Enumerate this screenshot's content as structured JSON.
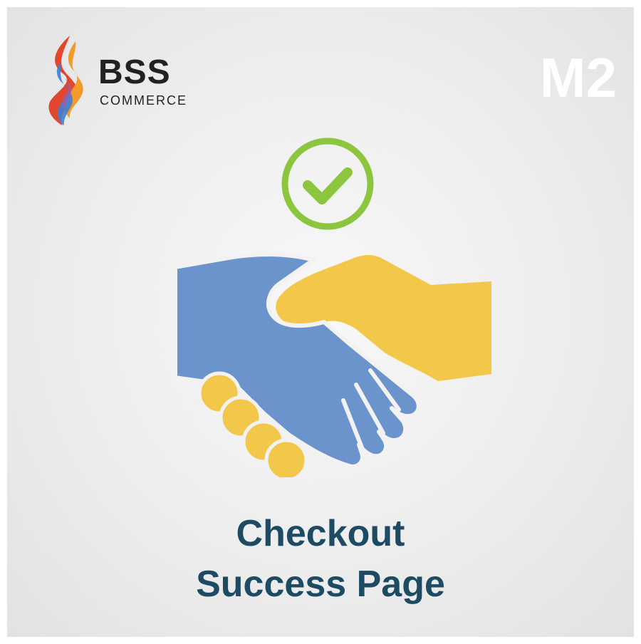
{
  "brand": {
    "name": "BSS",
    "subtitle": "COMMERCE"
  },
  "badge": {
    "version": "M2"
  },
  "product": {
    "title_line1": "Checkout",
    "title_line2": "Success Page"
  },
  "icons": {
    "logo": "flame-logo-icon",
    "check": "checkmark-circle-icon",
    "handshake": "handshake-icon"
  },
  "colors": {
    "title": "#1c4b63",
    "check_green": "#8cc63f",
    "hand_blue": "#6b93cc",
    "hand_yellow": "#f3c74a"
  }
}
